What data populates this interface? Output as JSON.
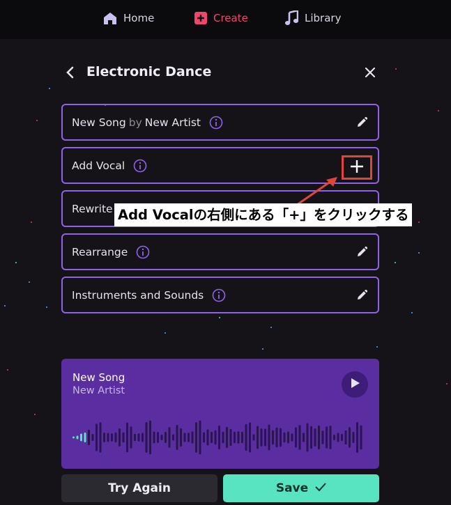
{
  "nav": {
    "home": "Home",
    "create": "Create",
    "library": "Library"
  },
  "header": {
    "title": "Electronic Dance"
  },
  "rows": {
    "song_title": "New Song",
    "by": "by",
    "artist": "New Artist",
    "add_vocal": "Add Vocal",
    "rewrite": "Rewrite",
    "rearrange": "Rearrange",
    "instruments": "Instruments and Sounds"
  },
  "annotation": "Add Vocalの右側にある「+」をクリックする",
  "player": {
    "title": "New Song",
    "artist": "New Artist"
  },
  "buttons": {
    "try_again": "Try Again",
    "save": "Save"
  },
  "colors": {
    "accent_nav": "#f0456c",
    "row_border": "#8f63e8",
    "player_bg": "#5a2da0",
    "save_bg": "#58e3c1",
    "highlight": "#e0453b"
  }
}
